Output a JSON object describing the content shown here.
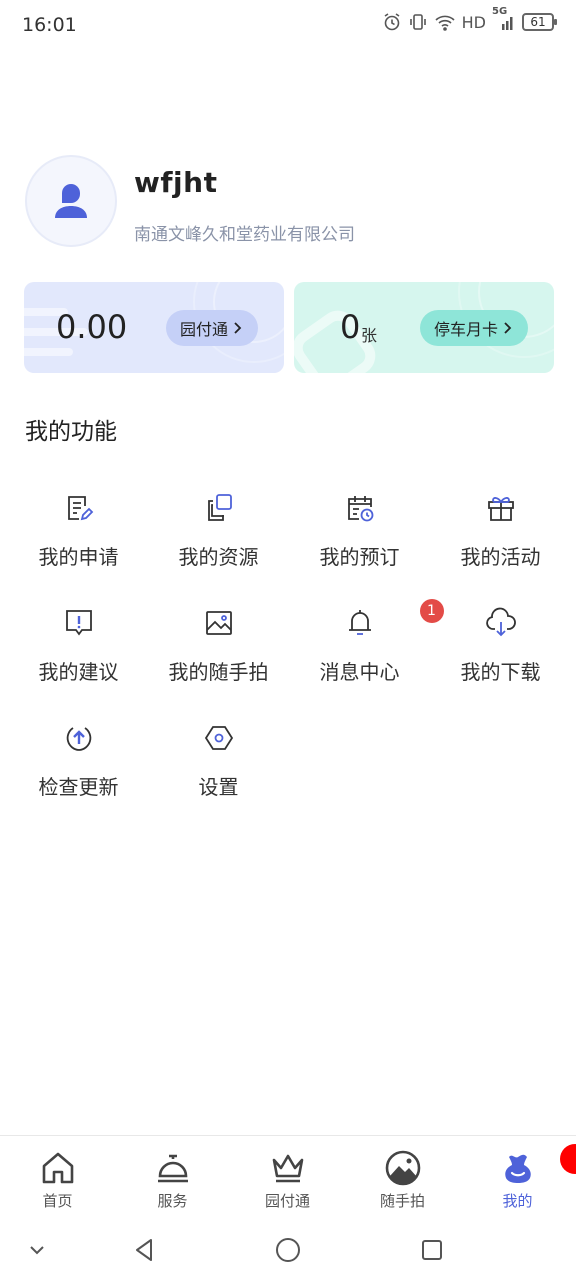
{
  "status_bar": {
    "time": "16:01",
    "network": "HD",
    "signal": "5G",
    "battery": "61"
  },
  "profile": {
    "username": "wfjht",
    "company": "南通文峰久和堂药业有限公司"
  },
  "cards": {
    "balance": {
      "value": "0.00",
      "button_label": "园付通"
    },
    "parking": {
      "count": "0",
      "unit": "张",
      "button_label": "停车月卡"
    }
  },
  "section_title": "我的功能",
  "functions": [
    {
      "label": "我的申请",
      "icon": "edit-document-icon"
    },
    {
      "label": "我的资源",
      "icon": "copy-resources-icon"
    },
    {
      "label": "我的预订",
      "icon": "calendar-clock-icon"
    },
    {
      "label": "我的活动",
      "icon": "gift-icon"
    },
    {
      "label": "我的建议",
      "icon": "feedback-icon"
    },
    {
      "label": "我的随手拍",
      "icon": "image-icon"
    },
    {
      "label": "消息中心",
      "icon": "bell-icon",
      "badge": "1"
    },
    {
      "label": "我的下载",
      "icon": "cloud-download-icon"
    },
    {
      "label": "检查更新",
      "icon": "update-icon"
    },
    {
      "label": "设置",
      "icon": "hexagon-settings-icon"
    }
  ],
  "bottom_nav": [
    {
      "label": "首页",
      "icon": "home-icon",
      "active": false
    },
    {
      "label": "服务",
      "icon": "service-bell-icon",
      "active": false
    },
    {
      "label": "园付通",
      "icon": "crown-icon",
      "active": false
    },
    {
      "label": "随手拍",
      "icon": "photo-icon",
      "active": false
    },
    {
      "label": "我的",
      "icon": "profile-icon",
      "active": true
    }
  ],
  "colors": {
    "accent": "#4e62d9",
    "badge": "#e34b47",
    "card_left": "#e2e8fc",
    "card_right": "#d6f6ee"
  }
}
